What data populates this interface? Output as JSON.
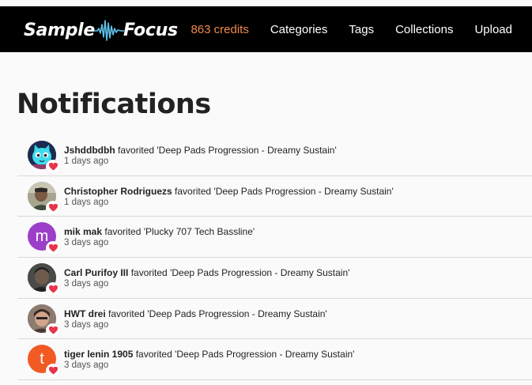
{
  "header": {
    "logo_left": "Sample",
    "logo_right": "Focus",
    "credits": "863 credits",
    "nav": [
      "Categories",
      "Tags",
      "Collections",
      "Upload"
    ]
  },
  "page": {
    "title": "Notifications"
  },
  "colors": {
    "accent": "#f08a4b",
    "heart": "#e8344b",
    "purple": "#9b3fc9",
    "orange": "#f25a24"
  },
  "notifications": [
    {
      "user": "Jshddbdbh",
      "action": "favorited",
      "item": "'Deep Pads Progression - Dreamy Sustain'",
      "time": "1 days ago",
      "avatar": "cat-character-avatar"
    },
    {
      "user": "Christopher Rodriguezs",
      "action": "favorited",
      "item": "'Deep Pads Progression - Dreamy Sustain'",
      "time": "1 days ago",
      "avatar": "photo-avatar"
    },
    {
      "user": "mik mak",
      "action": "favorited",
      "item": "'Plucky 707 Tech Bassline'",
      "time": "3 days ago",
      "avatar": "letter-avatar",
      "initial": "m"
    },
    {
      "user": "Carl Purifoy III",
      "action": "favorited",
      "item": "'Deep Pads Progression - Dreamy Sustain'",
      "time": "3 days ago",
      "avatar": "photo-avatar"
    },
    {
      "user": "HWT drei",
      "action": "favorited",
      "item": "'Deep Pads Progression - Dreamy Sustain'",
      "time": "3 days ago",
      "avatar": "photo-avatar"
    },
    {
      "user": "tiger lenin 1905",
      "action": "favorited",
      "item": "'Deep Pads Progression - Dreamy Sustain'",
      "time": "3 days ago",
      "avatar": "letter-avatar",
      "initial": "t"
    }
  ]
}
